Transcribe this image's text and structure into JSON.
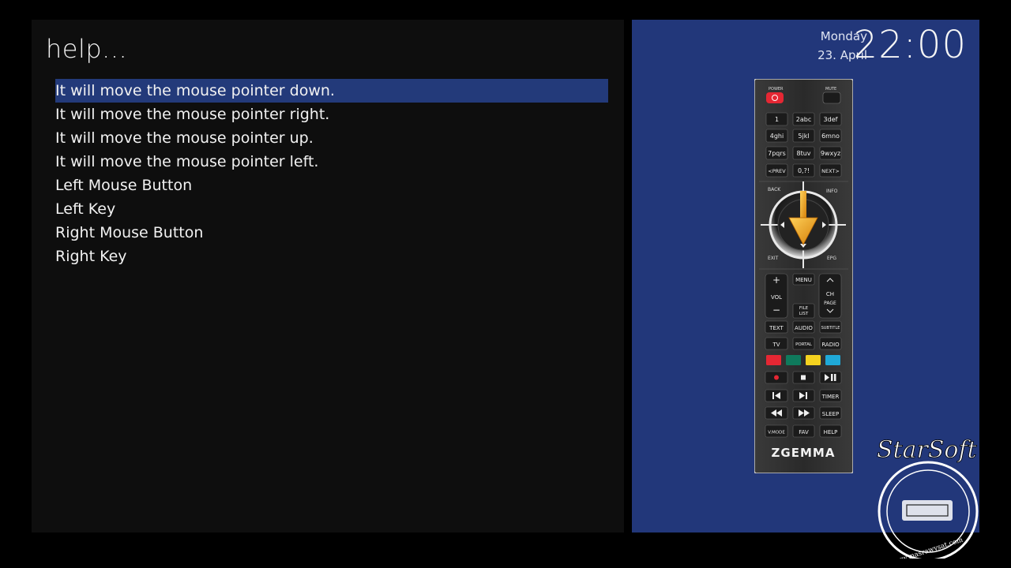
{
  "help_panel": {
    "title": "help...",
    "items": [
      {
        "label": "It will move the mouse pointer down.",
        "selected": true
      },
      {
        "label": "It will move the mouse pointer right.",
        "selected": false
      },
      {
        "label": "It will move the mouse pointer up.",
        "selected": false
      },
      {
        "label": "It will move the mouse pointer left.",
        "selected": false
      },
      {
        "label": "Left Mouse Button",
        "selected": false
      },
      {
        "label": "Left Key",
        "selected": false
      },
      {
        "label": "Right Mouse Button",
        "selected": false
      },
      {
        "label": "Right Key",
        "selected": false
      }
    ]
  },
  "clock": {
    "day": "Monday",
    "date": "23. April",
    "time": "22:00"
  },
  "remote": {
    "brand": "ZGEMMA",
    "power_label": "POWER",
    "mute_label": "MUTE",
    "number_keys": [
      "1",
      "2abc",
      "3def",
      "4ghi",
      "5jkl",
      "6mno",
      "7pqrs",
      "8tuv",
      "9wxyz",
      "<PREV",
      "0,?!",
      "NEXT>"
    ],
    "back_label": "BACK",
    "info_label": "INFO",
    "exit_label": "EXIT",
    "epg_label": "EPG",
    "vol_label": "VOL",
    "menu_label": "MENU",
    "file_label": "FILE",
    "list_label": "LIST",
    "ch_label": "CH",
    "page_label": "PAGE",
    "function_keys": [
      "TEXT",
      "AUDIO",
      "SUBTITLE",
      "TV",
      "PORTAL",
      "RADIO"
    ],
    "color_keys": [
      "#e52733",
      "#0f7a5c",
      "#f4d21f",
      "#1fa9d8"
    ],
    "timer_label": "TIMER",
    "sleep_label": "SLEEP",
    "vmode_label": "V.MODE",
    "fav_label": "FAV",
    "help_label": "HELP",
    "highlighted_key": "down arrow"
  },
  "watermark": {
    "text": "StarSoft",
    "url": "www.masrawysat.com"
  },
  "colors": {
    "selection": "#233a7a",
    "right_panel": "#22377a",
    "left_panel": "#0e0e0e",
    "arrow": "#f2a41b"
  }
}
